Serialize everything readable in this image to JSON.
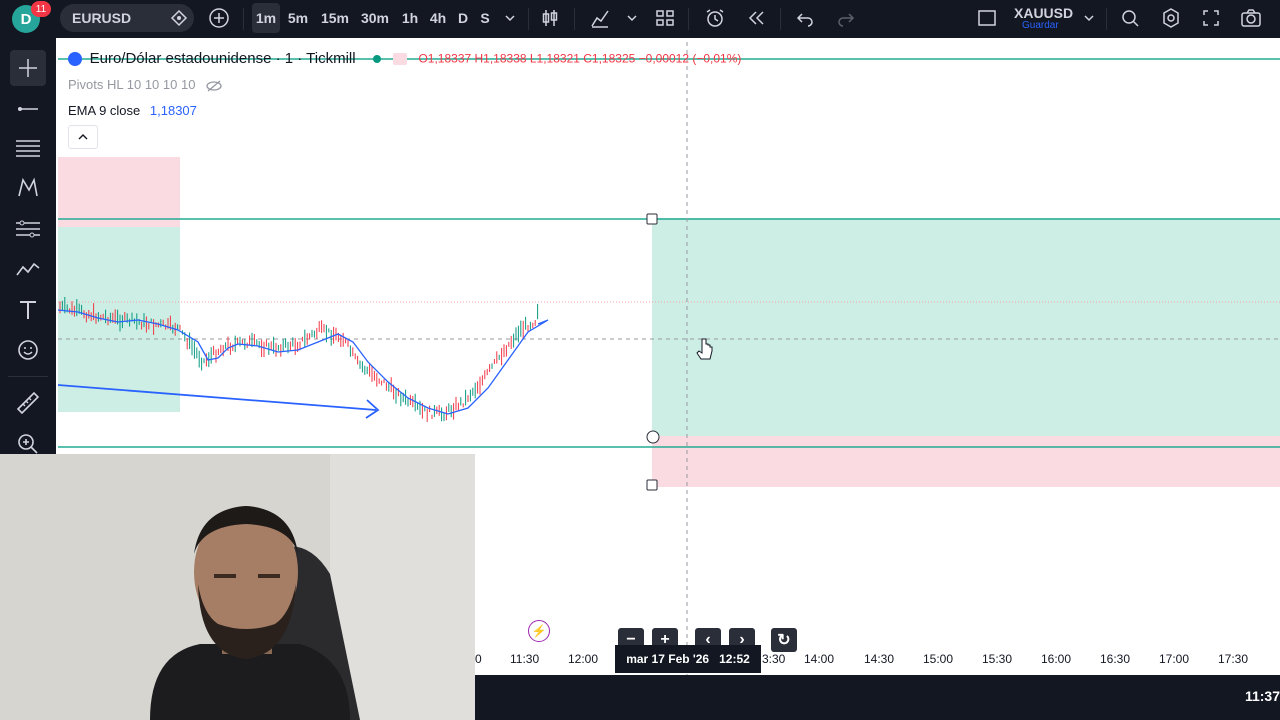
{
  "topbar": {
    "avatar_letter": "D",
    "notification_count": "11",
    "symbol": "EURUSD",
    "intervals": [
      "1m",
      "5m",
      "15m",
      "30m",
      "1h",
      "4h",
      "D",
      "S"
    ],
    "active_interval": "1m",
    "right_symbol": "XAUUSD",
    "right_symbol_sub": "Guardar"
  },
  "legend": {
    "title": "Euro/Dólar estadounidense · 1 · Tickmill",
    "ohlc": "O1,18337  H1,18338  L1,18321  C1,18325  −0,00012 (−0,01%)",
    "pivots": "Pivots HL 10 10 10 10",
    "ema_label": "EMA 9 close",
    "ema_value": "1,18307"
  },
  "time_axis": {
    "labels": [
      "0",
      "11:30",
      "12:00",
      "3:30",
      "14:00",
      "14:30",
      "15:00",
      "15:30",
      "16:00",
      "16:30",
      "17:00",
      "17:30"
    ],
    "crosshair_label": "mar 17 Feb '26   12:52"
  },
  "clock": "11:37",
  "colors": {
    "panel": "#131722",
    "profit_zone": "#cdeee4",
    "loss_zone": "#fadbe1",
    "line_teal": "#22ab94",
    "ema_blue": "#2962ff",
    "accent_blue": "#2962ff"
  },
  "icons": {
    "left_tools": [
      "crosshair-icon",
      "trendline-icon",
      "horizontal-lines-icon",
      "pattern-icon",
      "fib-icon",
      "brush-icon",
      "text-icon",
      "emoji-icon",
      "ruler-icon",
      "zoom-icon"
    ]
  }
}
